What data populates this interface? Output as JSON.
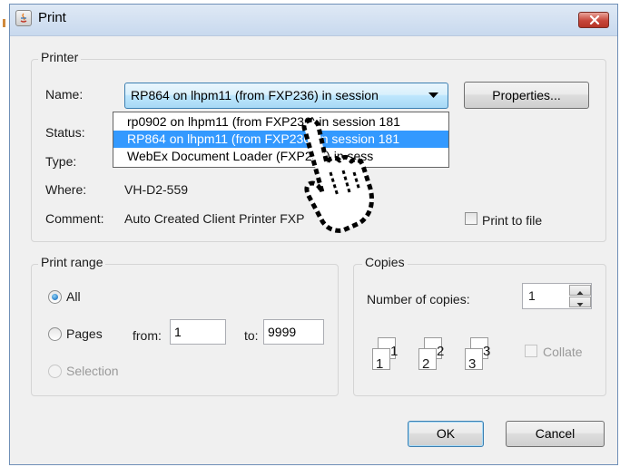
{
  "window": {
    "title": "Print"
  },
  "printer": {
    "group_label": "Printer",
    "name_label": "Name:",
    "selected_printer": "RP864 on lhpm11 (from FXP236) in session",
    "properties_label": "Properties...",
    "status_label": "Status:",
    "type_label": "Type:",
    "where_label": "Where:",
    "where_value": "VH-D2-559",
    "comment_label": "Comment:",
    "comment_value": "Auto Created Client Printer FXP",
    "print_to_file_label": "Print to file",
    "dropdown_items": [
      "rp0902 on lhpm11 (from FXP236) in session 181",
      "RP864 on lhpm11 (from FXP236) in session 181",
      "WebEx Document Loader        (FXP236) in sess"
    ]
  },
  "print_range": {
    "group_label": "Print range",
    "all_label": "All",
    "pages_label": "Pages",
    "from_label": "from:",
    "from_value": "1",
    "to_label": "to:",
    "to_value": "9999",
    "selection_label": "Selection"
  },
  "copies": {
    "group_label": "Copies",
    "number_label": "Number of copies:",
    "number_value": "1",
    "collate_label": "Collate",
    "page_numbers": [
      "1",
      "1",
      "2",
      "2",
      "3",
      "3"
    ]
  },
  "footer": {
    "ok_label": "OK",
    "cancel_label": "Cancel"
  },
  "colors": {
    "selection": "#3399ff",
    "accent_border": "#3c7fb1",
    "close_button": "#c7463a"
  }
}
